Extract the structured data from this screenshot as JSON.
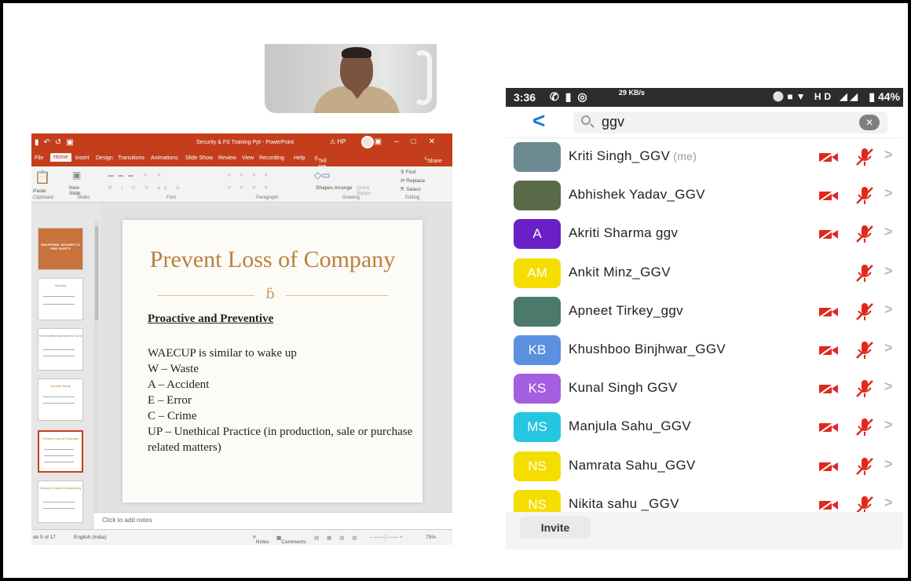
{
  "ppt": {
    "window_title": "Security & FS Training Ppt  -  PowerPoint",
    "account": "HP",
    "tabs": [
      "File",
      "Home",
      "Insert",
      "Design",
      "Transitions",
      "Animations",
      "Slide Show",
      "Review",
      "View",
      "Recording",
      "Help"
    ],
    "tell_me": "Tell me what you want to do",
    "share": "Share",
    "ribbon": {
      "paste": "Paste",
      "clipboard": "Clipboard",
      "new_slide": "New Slide",
      "slides": "Slides",
      "font": "Font",
      "paragraph": "Paragraph",
      "shapes_arrange": "Shapes Arrange",
      "quick_styles": "Quick Styles",
      "drawing": "Drawing",
      "find": "Find",
      "replace": "Replace",
      "select": "Select",
      "editing": "Editing"
    },
    "thumbnails": [
      {
        "title": "INDUSTRIAL SECURITY & FIRE SAFETY"
      },
      {
        "title": "Security"
      },
      {
        "title": "Vulnerability Assessment Tools"
      },
      {
        "title": "Security Setup"
      },
      {
        "title": "Prevent Loss of Company"
      },
      {
        "title": "Security Control & Monitoring"
      }
    ],
    "slide": {
      "title": "Prevent Loss of Company",
      "ornament": "ɓ",
      "subtitle": "Proactive and Preventive",
      "lines": [
        "WAECUP is similar to wake up",
        "W – Waste",
        "A – Accident",
        "E – Error",
        "C – Crime",
        "UP – Unethical Practice (in production, sale or purchase related matters)"
      ]
    },
    "notes_placeholder": "Click to add notes",
    "status": {
      "slide_counter": "de 5 of 17",
      "language": "English (India)",
      "notes": "Notes",
      "comments": "Comments",
      "zoom": "75%"
    }
  },
  "phone": {
    "status_bar": {
      "time": "3:36",
      "speed": "29 KB/s",
      "network": "HD",
      "battery": "44%"
    },
    "search": {
      "value": "ggv"
    },
    "participants": [
      {
        "name": "Kriti Singh_GGV",
        "me": "(me)",
        "initials": "",
        "color": "#6d8a93",
        "video_off": true,
        "mic_off": true
      },
      {
        "name": "Abhishek Yadav_GGV",
        "initials": "",
        "color": "#5a6b4a",
        "video_off": true,
        "mic_off": true
      },
      {
        "name": "Akriti Sharma ggv",
        "initials": "A",
        "color": "#6a1fc7",
        "video_off": true,
        "mic_off": true
      },
      {
        "name": "Ankit Minz_GGV",
        "initials": "AM",
        "color": "#f4de00",
        "video_off": false,
        "mic_off": true
      },
      {
        "name": "Apneet Tirkey_ggv",
        "initials": "",
        "color": "#4c7a6a",
        "video_off": true,
        "mic_off": true
      },
      {
        "name": "Khushboo Binjhwar_GGV",
        "initials": "KB",
        "color": "#5b8fe0",
        "video_off": true,
        "mic_off": true
      },
      {
        "name": "Kunal Singh GGV",
        "initials": "KS",
        "color": "#a45ee0",
        "video_off": true,
        "mic_off": true
      },
      {
        "name": "Manjula Sahu_GGV",
        "initials": "MS",
        "color": "#27c6e0",
        "video_off": true,
        "mic_off": true
      },
      {
        "name": "Namrata Sahu_GGV",
        "initials": "NS",
        "color": "#f4de00",
        "video_off": true,
        "mic_off": true
      },
      {
        "name": "Nikita sahu _GGV",
        "initials": "NS",
        "color": "#f4de00",
        "video_off": true,
        "mic_off": true
      }
    ],
    "invite_label": "Invite",
    "colors": {
      "accent": "#1678d6",
      "muted_red": "#e0281d"
    }
  }
}
